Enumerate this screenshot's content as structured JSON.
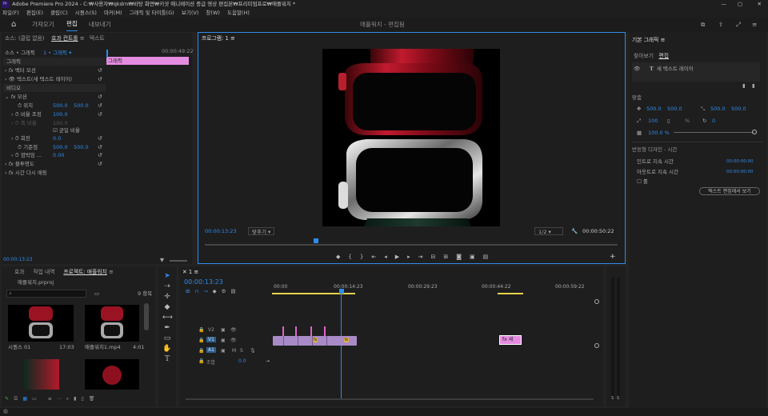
{
  "app": {
    "title": "Adobe Premiere Pro 2024 - C:₩사용자₩qkdrn₩바탕 화면₩키샷 애니메이션 중급 영상 편집본₩프리미엄프로₩애플워치 *",
    "logo": "Pr"
  },
  "menu": [
    "파일(F)",
    "편집(E)",
    "클립(C)",
    "시퀀스(S)",
    "마커(M)",
    "그래픽 및 타이틀(G)",
    "보기(V)",
    "창(W)",
    "도움말(H)"
  ],
  "workspace": {
    "tabs": [
      "가져오기",
      "편집",
      "내보내기"
    ],
    "active": "편집",
    "center": "애플워치 - 편집됨"
  },
  "effect_controls": {
    "tabs": [
      "소스: (클립 없음)",
      "효과 컨트롤",
      "텍스트"
    ],
    "source": "소스 • 그래픽",
    "target": "1 • 그래픽",
    "ruler_time": "00:00:49:22",
    "clip_label": "그래픽",
    "section1": "그래픽",
    "vector_motion": "벡터 모션",
    "text_layer": "텍스트(새 텍스트 레이어)",
    "section2": "비디오",
    "motion": "모션",
    "position": "위치",
    "position_x": "500.0",
    "position_y": "500.0",
    "scale": "비율 조정",
    "scale_val": "100.0",
    "scale_w": "폭 비율",
    "scale_w_val": "100.0",
    "uniform": "균일 비율",
    "rotation": "회전",
    "rotation_val": "0.0",
    "anchor": "기준점",
    "anchor_x": "500.0",
    "anchor_y": "500.0",
    "flicker": "깜박임 ...",
    "flicker_val": "0.00",
    "opacity": "불투명도",
    "time_remap": "시간 다시 매핑",
    "time": "00:00:13:23"
  },
  "program": {
    "title": "프로그램: 1",
    "timecode": "00:00:13:23",
    "fit": "맞추기",
    "quality": "1/2",
    "duration": "00:00:50:22"
  },
  "essential": {
    "title": "기본 그래픽",
    "tabs": [
      "찾아보기",
      "편집"
    ],
    "layer": "새 텍스트 레이어",
    "align": "맞춤",
    "pos_x": "500.0",
    "pos_y": "500.0",
    "anchor_x": "500.0",
    "anchor_y": "500.0",
    "scale": "100",
    "scale_pct": "%",
    "rotation": "0",
    "opacity": "100.0 %",
    "responsive": "반응형 디자인 - 시간",
    "intro": "인트로 지속 시간",
    "intro_val": "00:00:00:00",
    "outro": "아웃트로 지속 시간",
    "outro_val": "00:00:00:00",
    "roll": "롤",
    "edit_text_btn": "텍스트 편집에서 보기"
  },
  "project": {
    "tabs": [
      "효과",
      "작업 내역",
      "프로젝트: 애플워치"
    ],
    "file": "애플워치.prproj",
    "count": "9 항목",
    "items": [
      {
        "name": "시퀀스 01",
        "dur": "17:03"
      },
      {
        "name": "애플워치1.mp4",
        "dur": "4:01"
      }
    ]
  },
  "timeline": {
    "tab": "1",
    "timecode": "00:00:13:23",
    "ruler": [
      "00:00",
      "00:00:14:23",
      "00:00:29:23",
      "00:00:44:22",
      "00:00:59:22"
    ],
    "tracks": [
      {
        "name": "V2"
      },
      {
        "name": "V1"
      },
      {
        "name": "A1"
      },
      {
        "name": "조합",
        "val": "0.0"
      }
    ],
    "clip_label": "새"
  },
  "meter": {
    "labels": [
      "S",
      "S"
    ]
  },
  "colors": {
    "accent": "#2d8ceb",
    "clip": "#a88bc6",
    "marker": "#e264c8",
    "graphic": "#e48ce0"
  }
}
